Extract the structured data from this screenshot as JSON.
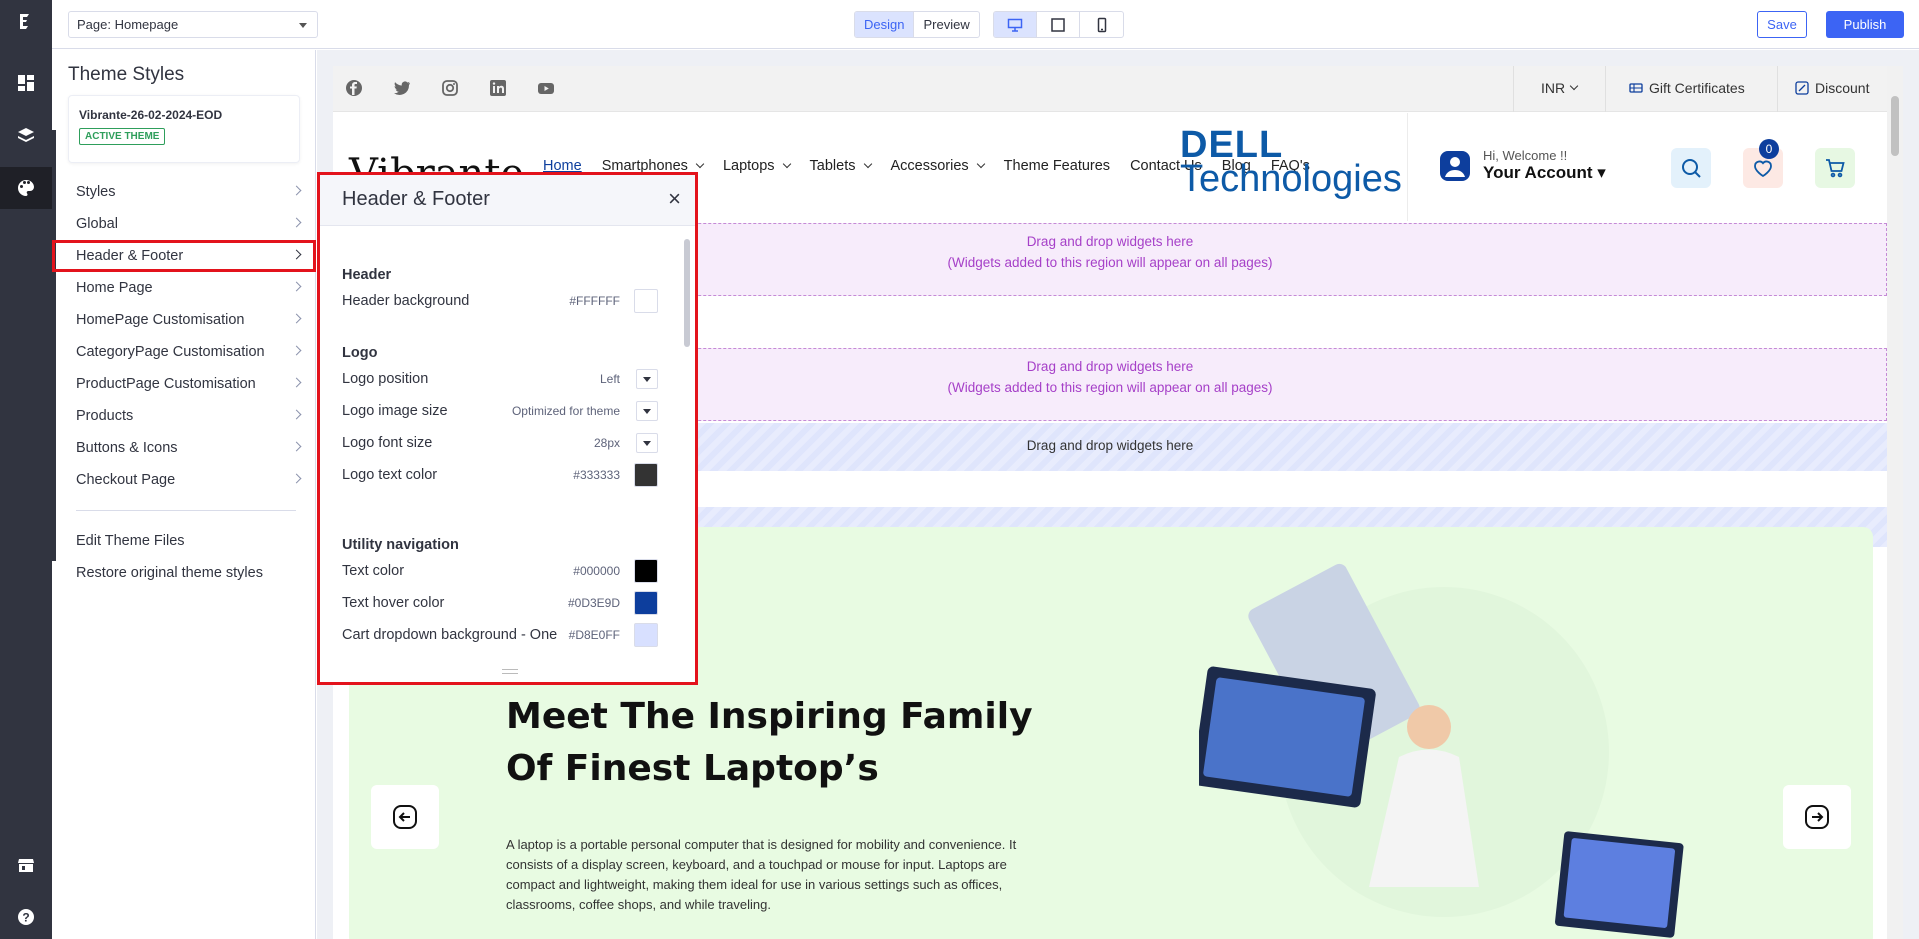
{
  "topbar": {
    "page_select": "Page: Homepage",
    "mode_design": "Design",
    "mode_preview": "Preview",
    "save": "Save",
    "publish": "Publish"
  },
  "panel": {
    "title": "Theme Styles",
    "theme_name": "Vibrante-26-02-2024-EOD",
    "theme_badge": "ACTIVE THEME",
    "menu": [
      "Styles",
      "Global",
      "Header & Footer",
      "Home Page",
      "HomePage Customisation",
      "CategoryPage Customisation",
      "ProductPage Customisation",
      "Products",
      "Buttons & Icons",
      "Checkout Page"
    ],
    "links": [
      "Edit Theme Files",
      "Restore original theme styles"
    ]
  },
  "flyout": {
    "title": "Header & Footer",
    "close": "×",
    "header_group": "Header",
    "header_background_label": "Header background",
    "header_background_value": "#FFFFFF",
    "logo_group": "Logo",
    "logo_position_label": "Logo position",
    "logo_position_value": "Left",
    "logo_image_size_label": "Logo image size",
    "logo_image_size_value": "Optimized for theme",
    "logo_font_size_label": "Logo font size",
    "logo_font_size_value": "28px",
    "logo_text_color_label": "Logo text color",
    "logo_text_color_value": "#333333",
    "utility_group": "Utility navigation",
    "text_color_label": "Text color",
    "text_color_value": "#000000",
    "text_hover_color_label": "Text hover color",
    "text_hover_color_value": "#0D3E9D",
    "cart_dropdown_label": "Cart dropdown background - One",
    "cart_dropdown_value": "#D8E0FF"
  },
  "colors": {
    "header_bg": "#FFFFFF",
    "logo_text": "#333333",
    "text": "#000000",
    "text_hover": "#0D3E9D",
    "cart_dropdown": "#D8E0FF",
    "accent": "#3C64F4",
    "highlight": "#E3131C"
  },
  "store": {
    "currency": "INR",
    "gift_certificates": "Gift Certificates",
    "discount": "Discount",
    "logo_text": "Vibrante",
    "nav": [
      "Home",
      "Smartphones",
      "Laptops",
      "Tablets",
      "Accessories",
      "Theme Features",
      "Contact Us",
      "Blog",
      "FAQ's"
    ],
    "welcome": "Hi, Welcome !!",
    "account": "Your Account ▾",
    "cart_count": "0",
    "dropzone_title": "Drag and drop widgets here",
    "dropzone_sub": "(Widgets added to this region will appear on all pages)",
    "dropzone_plain": "Drag and drop widgets here",
    "hero_title": "Meet The Inspiring Family Of Finest Laptop’s",
    "hero_text": "A laptop is a portable personal computer that is designed for mobility and convenience. It consists of a display screen, keyboard, and a touchpad or mouse for input. Laptops are compact and lightweight, making them ideal for use in various settings such as offices, classrooms, coffee shops, and while traveling.",
    "brand_line1": "DELL",
    "brand_line2": "Technologies"
  }
}
